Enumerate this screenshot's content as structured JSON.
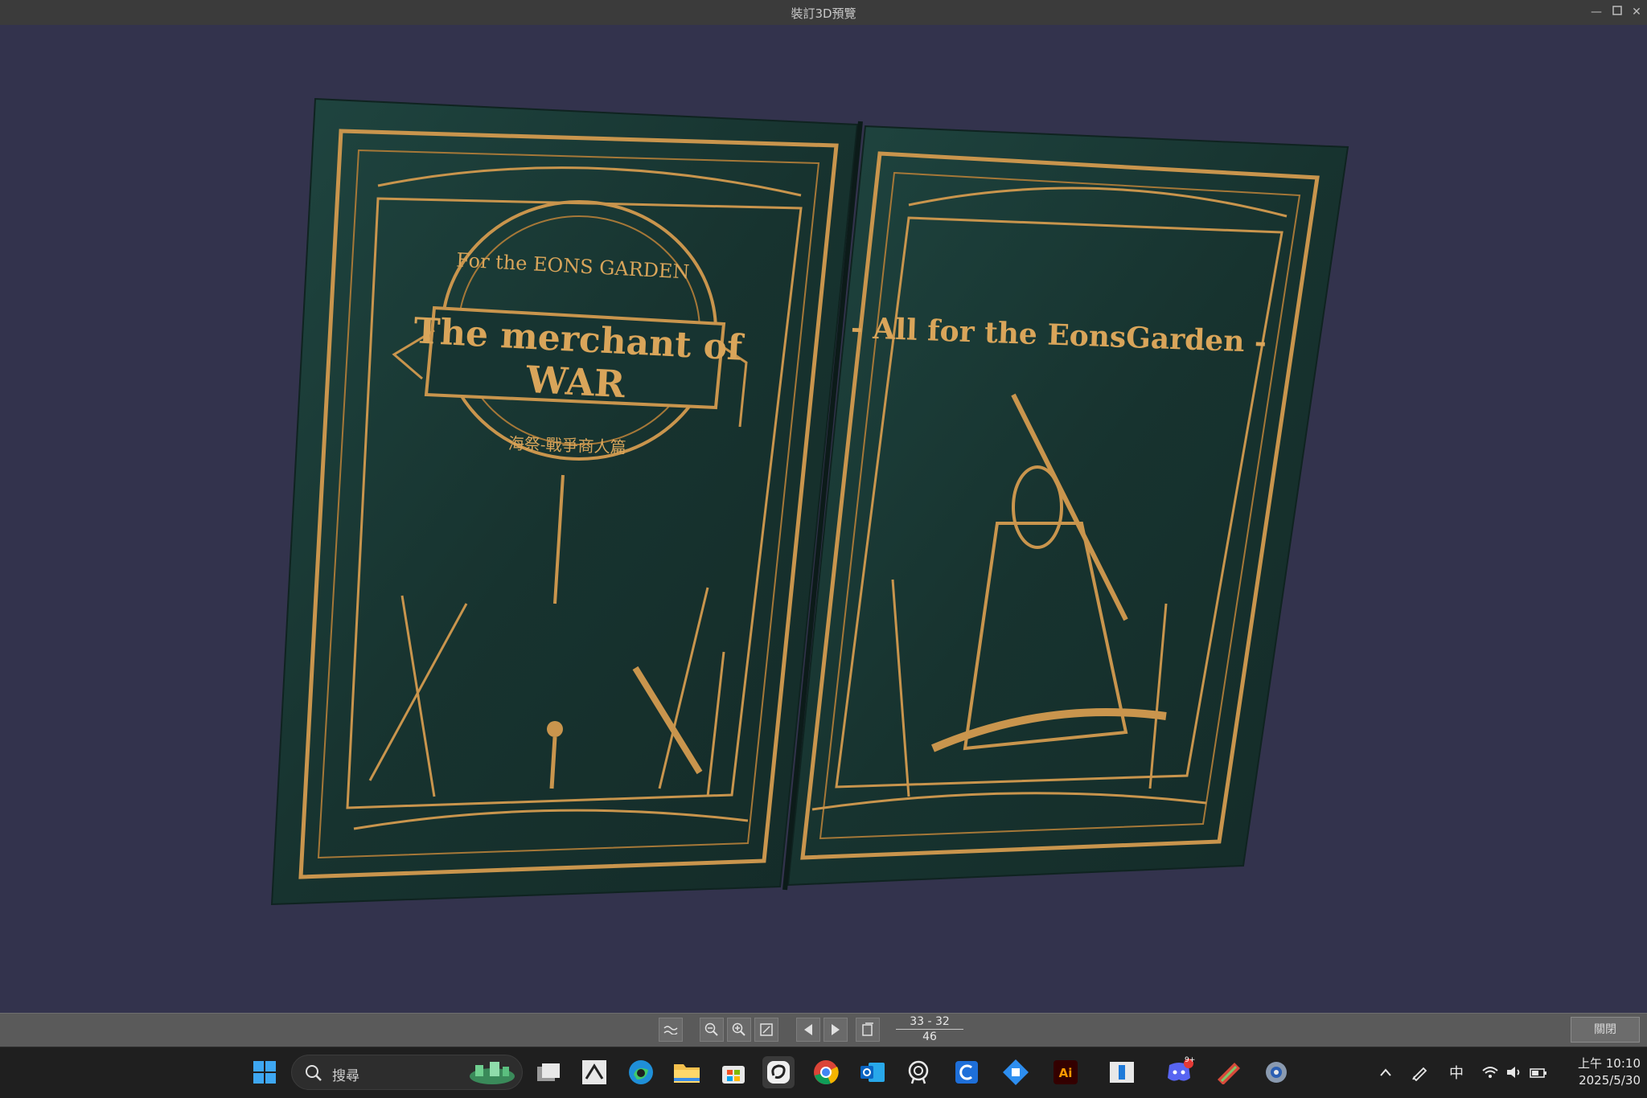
{
  "window": {
    "title": "裝訂3D預覽"
  },
  "book": {
    "left_page": {
      "subtitle_arc": "For the EONS GARDEN",
      "title_line1": "The merchant of",
      "title_line2": "WAR",
      "chinese_title": "海祭-戰爭商人篇"
    },
    "right_page": {
      "heading": "- All for the EonsGarden -"
    },
    "colors": {
      "background": "#33334d",
      "cover": "#1b3b37",
      "gold": "#c9954d"
    }
  },
  "toolbar": {
    "buttons": [
      "preview-mode-icon",
      "zoom-out-icon",
      "zoom-in-icon",
      "fit-view-icon",
      "prev-page-icon",
      "next-page-icon",
      "page-layout-icon"
    ],
    "page_spread": "33 - 32",
    "page_total": "46",
    "close_label": "關閉"
  },
  "taskbar": {
    "search_placeholder": "搜尋",
    "chat_badge": "9+",
    "ime_indicator": "中",
    "clock_time": "上午 10:10",
    "clock_date": "2025/5/30",
    "apps": [
      "start-icon",
      "task-view-icon",
      "zbrush-icon",
      "edge-icon",
      "file-explorer-icon",
      "store-icon",
      "clip-studio-icon",
      "chrome-icon",
      "outlook-icon",
      "github-icon",
      "clip-studio-paint-icon",
      "puzzle-app-icon",
      "illustrator-icon",
      "window-app-icon",
      "discord-icon",
      "brush-app-icon",
      "settings-icon"
    ]
  }
}
